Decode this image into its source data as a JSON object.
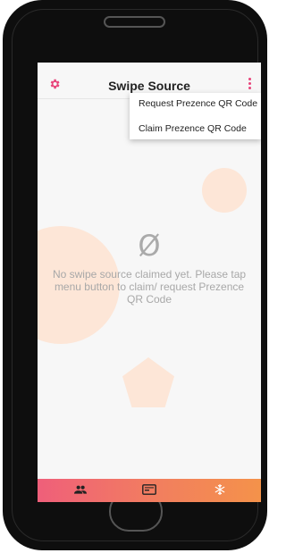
{
  "header": {
    "title": "Swipe Source",
    "settings_icon": "gear-icon",
    "menu_icon": "kebab-menu-icon",
    "accent_color": "#e8457b"
  },
  "menu": {
    "items": [
      {
        "label": "Request Prezence QR Code"
      },
      {
        "label": "Claim Prezence QR Code"
      }
    ]
  },
  "empty_state": {
    "icon": "Ø",
    "message": "No swipe source claimed yet. Please tap menu button to claim/ request Prezence QR Code"
  },
  "bottom_nav": {
    "items": [
      {
        "icon": "people-icon"
      },
      {
        "icon": "card-icon"
      },
      {
        "icon": "snowflake-icon"
      }
    ]
  }
}
